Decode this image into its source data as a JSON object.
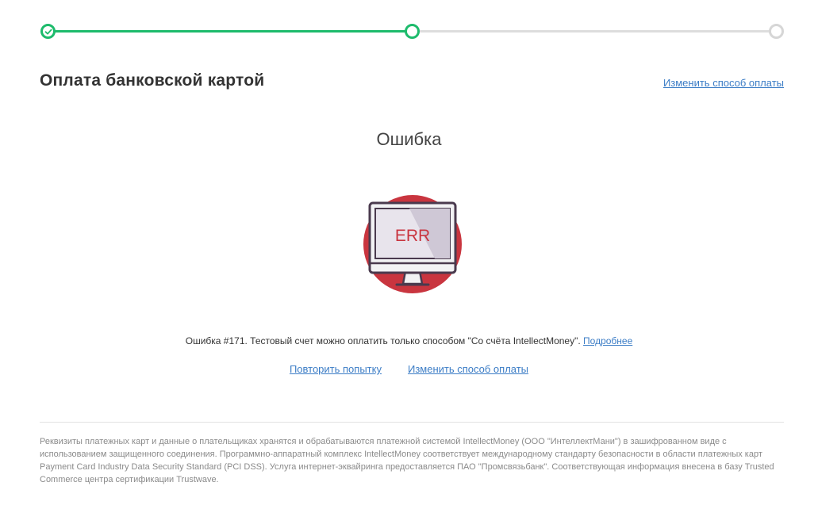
{
  "stepper": {
    "steps": [
      {
        "state": "completed",
        "icon": "check-icon"
      },
      {
        "state": "current",
        "icon": "circle-icon"
      },
      {
        "state": "upcoming",
        "icon": "circle-icon"
      }
    ],
    "progress_fraction": 0.5,
    "active_color": "#1dbb6c",
    "inactive_color": "#dddddd"
  },
  "header": {
    "title": "Оплата банковской картой",
    "change_method_link": "Изменить способ оплаты"
  },
  "error": {
    "heading": "Ошибка",
    "illustration_icon": "monitor-error-icon",
    "illustration_text": "ERR",
    "message": "Ошибка #171. Тестовый счет можно оплатить только способом \"Со счёта IntellectMoney\".",
    "details_link": "Подробнее",
    "accent_color": "#c9353f"
  },
  "actions": {
    "retry_link": "Повторить попытку",
    "change_method_link": "Изменить способ оплаты"
  },
  "footer": {
    "text": "Реквизиты платежных карт и данные о плательщиках хранятся и обрабатываются платежной системой IntellectMoney (ООО \"ИнтеллектМани\") в зашифрованном виде с использованием защищенного соединения. Программно-аппаратный комплекс IntellectMoney соответствует международному стандарту безопасности в области платежных карт Payment Card Industry Data Security Standard (PCI DSS). Услуга интернет-эквайринга предоставляется ПАО \"Промсвязьбанк\". Соответствующая информация внесена в базу Trusted Commerce центра сертификации Trustwave."
  },
  "colors": {
    "link": "#3c7dc6",
    "text": "#333333",
    "muted": "#8a8a8a"
  }
}
